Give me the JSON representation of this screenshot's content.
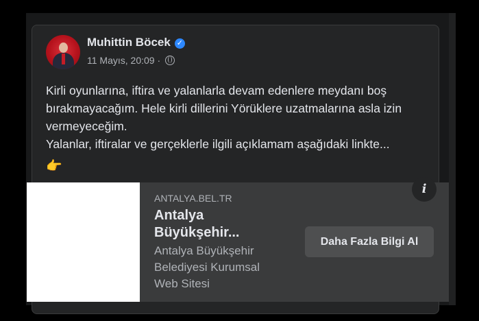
{
  "post": {
    "author_name": "Muhittin Böcek",
    "verified_glyph": "✓",
    "date": "11 Mayıs, 20:09 ·",
    "paragraphs": [
      "Kirli oyunlarına, iftira ve yalanlarla devam edenlere meydanı boş bırakmayacağım. Hele kirli dillerini Yörüklere uzatmalarına asla izin vermeyeceğim.",
      "Yalanlar, iftiralar ve gerçeklerle ilgili açıklamam aşağıdaki linkte..."
    ],
    "emoji": "👉"
  },
  "link_preview": {
    "domain": "ANTALYA.BEL.TR",
    "title": "Antalya Büyükşehir...",
    "description": "Antalya Büyükşehir Belediyesi Kurumsal Web Sitesi",
    "cta_label": "Daha Fazla Bilgi Al",
    "info_glyph": "i"
  },
  "colors": {
    "background": "#18191a",
    "card": "#242526",
    "link_area": "#3a3b3c",
    "verified_blue": "#2d88ff",
    "primary_text": "#e4e6eb",
    "secondary_text": "#b0b3b8"
  },
  "icons": [
    "verified-badge-icon",
    "globe-icon",
    "info-icon",
    "pointing-hand-emoji"
  ]
}
